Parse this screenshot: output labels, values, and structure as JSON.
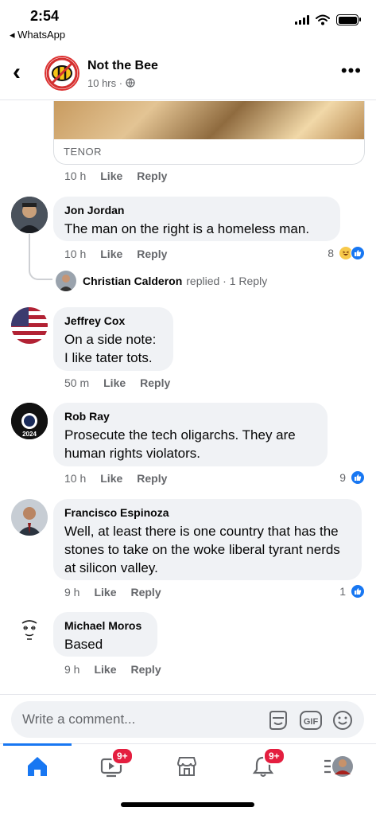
{
  "status_bar": {
    "time": "2:54",
    "back_app": "◂ WhatsApp"
  },
  "header": {
    "title": "Not the Bee",
    "subtitle": "10 hrs · ",
    "back_icon": "chevron-left-icon",
    "more_icon": "more-dots-icon",
    "globe_icon": "globe-icon"
  },
  "gif": {
    "label": "TENOR",
    "time": "10 h",
    "like": "Like",
    "reply": "Reply"
  },
  "comments": [
    {
      "name": "Jon Jordan",
      "text": "The man on the right is a homeless man.",
      "time": "10 h",
      "like": "Like",
      "reply": "Reply",
      "reactions": "8"
    },
    {
      "name": "Jeffrey Cox",
      "text": "On a side note:\nI like tater tots.",
      "time": "50 m",
      "like": "Like",
      "reply": "Reply"
    },
    {
      "name": "Rob Ray",
      "text": "Prosecute the tech oligarchs. They are human rights violators.",
      "time": "10 h",
      "like": "Like",
      "reply": "Reply",
      "reactions": "9"
    },
    {
      "name": "Francisco Espinoza",
      "text": "Well, at least there is one country that has the stones to take on the woke liberal tyrant nerds at silicon valley.",
      "time": "9 h",
      "like": "Like",
      "reply": "Reply",
      "reactions": "1"
    },
    {
      "name": "Michael Moros",
      "text": "Based",
      "time": "9 h",
      "like": "Like",
      "reply": "Reply"
    }
  ],
  "reply_thread": {
    "name": "Christian Calderon",
    "action": "replied",
    "meta": "· 1 Reply"
  },
  "composer": {
    "placeholder": "Write a comment...",
    "gif": "GIF"
  },
  "nav": {
    "video_badge": "9+",
    "notif_badge": "9+"
  },
  "colors": {
    "accent": "#1877f2",
    "badge": "#e41e3f",
    "bubble": "#f0f2f5",
    "muted": "#65676b"
  }
}
